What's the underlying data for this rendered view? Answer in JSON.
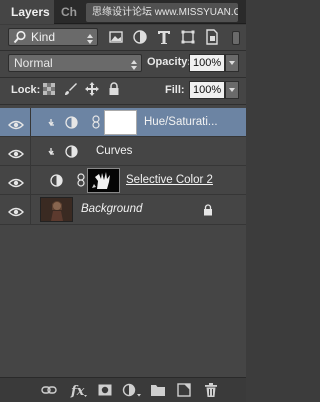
{
  "tabs": [
    {
      "label": "Layers",
      "active": true
    },
    {
      "label": "Ch",
      "active": false
    }
  ],
  "watermark": "思缘设计论坛 www.MISSYUAN.COM",
  "filter": {
    "kind_label": "Kind",
    "icons": [
      "pixel-filter-icon",
      "adjustment-filter-icon",
      "type-filter-icon",
      "shape-filter-icon",
      "smart-object-filter-icon"
    ]
  },
  "blend": {
    "mode": "Normal",
    "opacity_label": "Opacity:",
    "opacity_value": "100%"
  },
  "lock": {
    "label": "Lock:",
    "icons": [
      "lock-transparent-pixels-icon",
      "lock-image-pixels-icon",
      "lock-position-icon",
      "lock-all-icon"
    ],
    "fill_label": "Fill:",
    "fill_value": "100%"
  },
  "layers": [
    {
      "name": "Hue/Saturati...",
      "type": "adjustment",
      "clipped": true,
      "linked_mask": true,
      "mask": "white",
      "selected": true,
      "visible": true
    },
    {
      "name": "Curves",
      "type": "adjustment",
      "clipped": true,
      "linked_mask": false,
      "selected": false,
      "visible": true
    },
    {
      "name": "Selective Color 2",
      "type": "adjustment",
      "clipped": false,
      "linked_mask": true,
      "mask": "black-with-white",
      "selected": false,
      "visible": true
    },
    {
      "name": "Background",
      "type": "image",
      "locked": true,
      "selected": false,
      "visible": true
    }
  ],
  "bottom_actions": [
    "link-layers-icon",
    "fx-icon",
    "add-mask-icon",
    "new-adjustment-icon",
    "new-group-icon",
    "new-layer-icon",
    "trash-icon"
  ],
  "colors": {
    "panel": "#454545",
    "selected_row": "#6c84a3",
    "tab_bar": "#2a2a2a"
  }
}
